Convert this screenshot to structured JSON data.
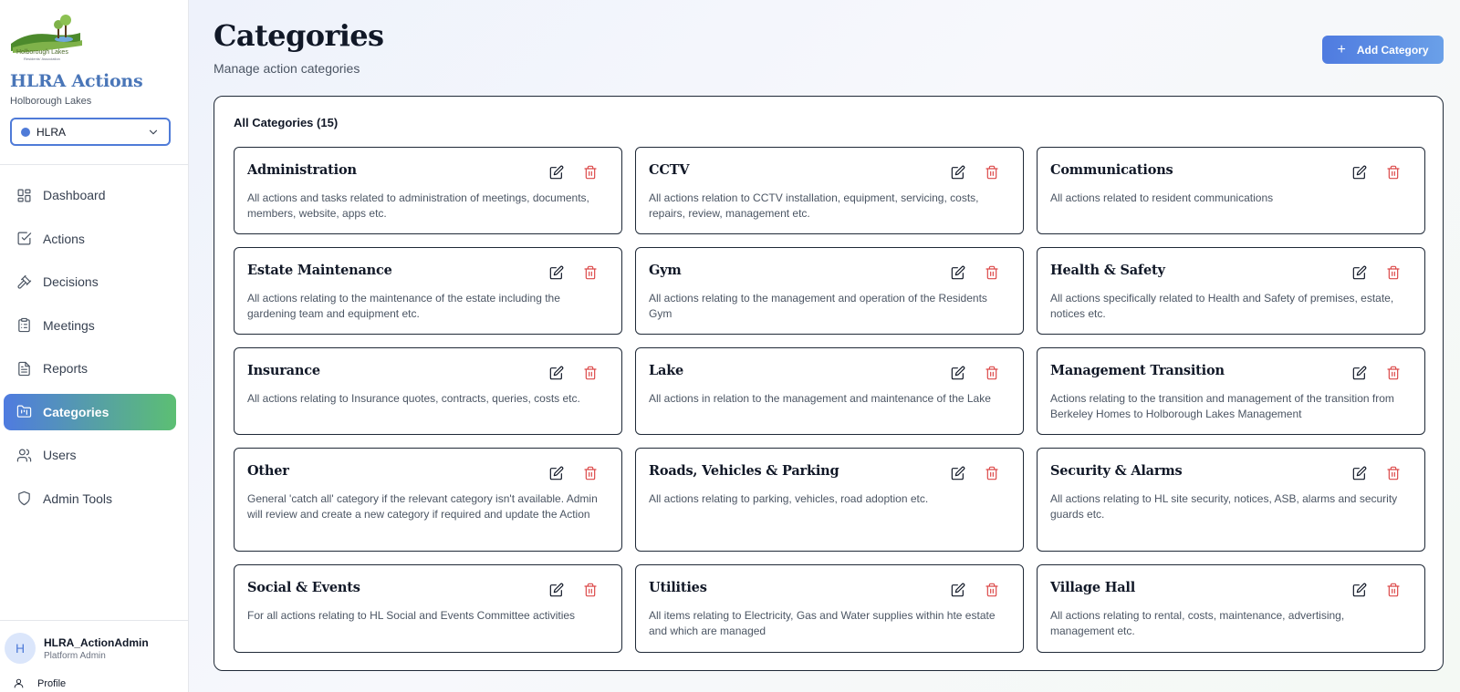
{
  "sidebar": {
    "logo_text": "Holborough Lakes",
    "logo_subtext": "Residents' Association",
    "app_title": "HLRA Actions",
    "app_subtitle": "Holborough Lakes",
    "org_select": {
      "value": "HLRA"
    },
    "nav": [
      {
        "label": "Dashboard",
        "icon": "dashboard-icon",
        "active": false
      },
      {
        "label": "Actions",
        "icon": "checkbox-icon",
        "active": false
      },
      {
        "label": "Decisions",
        "icon": "gavel-icon",
        "active": false
      },
      {
        "label": "Meetings",
        "icon": "clipboard-icon",
        "active": false
      },
      {
        "label": "Reports",
        "icon": "document-icon",
        "active": false
      },
      {
        "label": "Categories",
        "icon": "folder-icon",
        "active": true
      },
      {
        "label": "Users",
        "icon": "users-icon",
        "active": false
      },
      {
        "label": "Admin Tools",
        "icon": "shield-icon",
        "active": false
      }
    ],
    "user": {
      "initial": "H",
      "name": "HLRA_ActionAdmin",
      "role": "Platform Admin"
    },
    "profile_label": "Profile"
  },
  "header": {
    "title": "Categories",
    "subtitle": "Manage action categories",
    "add_button_label": "Add Category"
  },
  "panel": {
    "title": "All Categories (15)",
    "categories": [
      {
        "name": "Administration",
        "description": "All actions and tasks related to administration of meetings, documents, members, website, apps etc."
      },
      {
        "name": "CCTV",
        "description": "All actions relation to CCTV installation, equipment, servicing, costs, repairs, review, management etc."
      },
      {
        "name": "Communications",
        "description": "All actions related to resident communications"
      },
      {
        "name": "Estate Maintenance",
        "description": "All actions relating to the maintenance of the estate including the gardening team and equipment etc."
      },
      {
        "name": "Gym",
        "description": "All actions relating to the management and operation of the Residents Gym"
      },
      {
        "name": "Health & Safety",
        "description": "All actions specifically related to Health and Safety of premises, estate, notices etc."
      },
      {
        "name": "Insurance",
        "description": "All actions relating to Insurance quotes, contracts, queries, costs etc."
      },
      {
        "name": "Lake",
        "description": "All actions in relation to the management and maintenance of the Lake"
      },
      {
        "name": "Management Transition",
        "description": "Actions relating to the transition and management of the transition from Berkeley Homes to Holborough Lakes Management"
      },
      {
        "name": "Other",
        "description": "General 'catch all' category if the relevant category isn't available. Admin will review and create a new category if required and update the Action"
      },
      {
        "name": "Roads, Vehicles & Parking",
        "description": "All actions relating to parking, vehicles, road adoption etc."
      },
      {
        "name": "Security & Alarms",
        "description": "All actions relating to HL site security, notices, ASB, alarms and security guards etc."
      },
      {
        "name": "Social & Events",
        "description": "For all actions relating to HL Social and Events Committee activities"
      },
      {
        "name": "Utilities",
        "description": "All items relating to Electricity, Gas and Water supplies within hte estate and which are managed"
      },
      {
        "name": "Village Hall",
        "description": "All actions relating to rental, costs, maintenance, advertising, management etc."
      }
    ]
  },
  "colors": {
    "accent_blue": "#4f7be0",
    "accent_green": "#5cbf73",
    "brand_title": "#4a76b8",
    "delete_red": "#dc4a4a"
  }
}
